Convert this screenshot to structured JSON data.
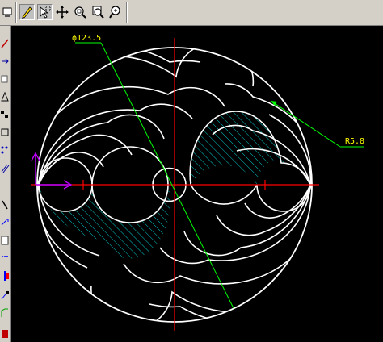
{
  "toolbar": {
    "tools": [
      {
        "name": "screen-icon"
      },
      {
        "name": "pencil-icon",
        "active": true
      },
      {
        "name": "select-tool-icon",
        "active": true
      },
      {
        "name": "pan-icon"
      },
      {
        "name": "zoom-window-icon"
      },
      {
        "name": "zoom-previous-icon"
      },
      {
        "name": "zoom-realtime-icon"
      }
    ]
  },
  "drawing": {
    "dimension_diameter": "ϕ123.5",
    "dimension_radius": "R5.8",
    "colors": {
      "background": "#000000",
      "geometry": "#ffffff",
      "centerline": "#ff0000",
      "leader": "#00ff00",
      "hatch": "#00c8c8",
      "text": "#ffff00",
      "ucs": "#c000ff"
    }
  }
}
